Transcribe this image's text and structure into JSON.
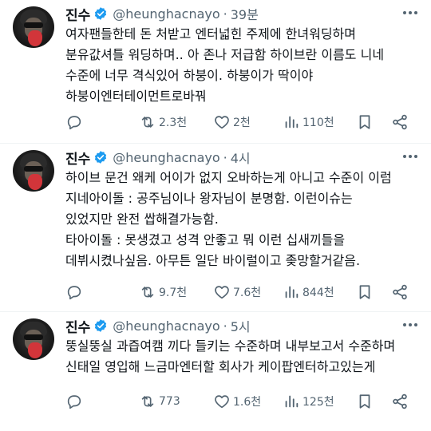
{
  "colors": {
    "verified": "#1d9bf0",
    "text": "#0f1419",
    "muted": "#536471",
    "divider": "#eff3f4"
  },
  "tweets": [
    {
      "name": "진수",
      "handle": "@heunghacnayo",
      "time": "39분",
      "text": "여자팬들한테 돈 처받고 엔터넓힌 주제에 한녀워딩하며\n분유값셔틀 워딩하며.. 아 존나 저급함 하이브란 이름도 니네\n수준에 너무 격식있어 하붕이. 하붕이가 딱이야\n하붕이엔터테이먼트로바꿔",
      "retweets": "2.3천",
      "likes": "2천",
      "views": "110천"
    },
    {
      "name": "진수",
      "handle": "@heunghacnayo",
      "time": "4시",
      "text": "하이브 문건 왜케 어이가 없지 오바하는게 아니고 수준이 이럼\n지네아이돌 : 공주님이나 왕자님이 분명함. 이런이슈는\n있었지만 완전 쌉해결가능함.\n타아이돌 : 못생겼고 성격 안좋고 뭐 이런 십새끼들을\n데뷔시켰나싶음. 아무튼 일단 바이럴이고 좆망할거같음.",
      "retweets": "9.7천",
      "likes": "7.6천",
      "views": "844천"
    },
    {
      "name": "진수",
      "handle": "@heunghacnayo",
      "time": "5시",
      "text": "뚱실뚱실 과즙여캠 끼다 들키는 수준하며 내부보고서 수준하며\n신태일 영입해 느금마엔터할 회사가 케이팝엔터하고있는게",
      "retweets": "773",
      "likes": "1.6천",
      "views": "125천"
    }
  ],
  "icons": {
    "reply": "reply-icon",
    "retweet": "retweet-icon",
    "like": "heart-icon",
    "views": "views-icon",
    "bookmark": "bookmark-icon",
    "share": "share-icon",
    "more": "more-icon",
    "verified": "verified-badge-icon"
  }
}
